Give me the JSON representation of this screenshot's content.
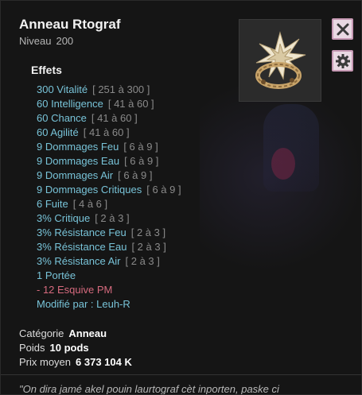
{
  "item": {
    "name": "Anneau Rtograf",
    "level_label": "Niveau",
    "level_value": "200"
  },
  "buttons": {
    "close_icon": "close-icon",
    "settings_icon": "gear-icon"
  },
  "effects": {
    "header": "Effets",
    "lines": [
      {
        "text": "300 Vitalité",
        "range": "[ 251 à 300 ]"
      },
      {
        "text": "60 Intelligence",
        "range": "[ 41 à 60 ]"
      },
      {
        "text": "60 Chance",
        "range": "[ 41 à 60 ]"
      },
      {
        "text": "60 Agilité",
        "range": "[ 41 à 60 ]"
      },
      {
        "text": "9 Dommages Feu",
        "range": "[ 6 à 9 ]"
      },
      {
        "text": "9 Dommages Eau",
        "range": "[ 6 à 9 ]"
      },
      {
        "text": "9 Dommages Air",
        "range": "[ 6 à 9 ]"
      },
      {
        "text": "9 Dommages Critiques",
        "range": "[ 6 à 9 ]"
      },
      {
        "text": "6 Fuite",
        "range": "[ 4 à 6 ]"
      },
      {
        "text": "3% Critique",
        "range": "[ 2 à 3 ]"
      },
      {
        "text": "3% Résistance Feu",
        "range": "[ 2 à 3 ]"
      },
      {
        "text": "3% Résistance Eau",
        "range": "[ 2 à 3 ]"
      },
      {
        "text": "3% Résistance Air",
        "range": "[ 2 à 3 ]"
      },
      {
        "text": "1 Portée",
        "range": ""
      }
    ],
    "negative": "- 12 Esquive PM",
    "modified_by": "Modifié par : Leuh-R"
  },
  "meta": {
    "category_label": "Catégorie",
    "category_value": "Anneau",
    "weight_label": "Poids",
    "weight_value": "10 pods",
    "price_label": "Prix moyen",
    "price_value": "6 373 104 K"
  },
  "flavor_text": "\"On dira jamé akel pouin laurtograf cèt inporten, paske ci",
  "colors": {
    "effect_positive": "#78c3d8",
    "effect_negative": "#d66a7e",
    "button_bg": "#e9d9e3"
  }
}
